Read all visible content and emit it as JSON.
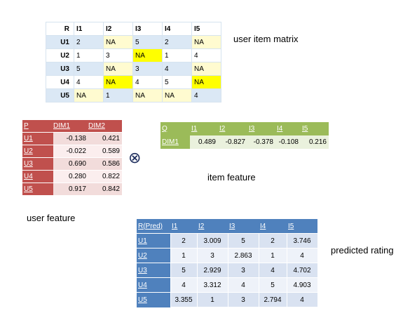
{
  "user_item_matrix": {
    "corner": "R",
    "columns": [
      "I1",
      "I2",
      "I3",
      "I4",
      "I5"
    ],
    "rows": [
      {
        "label": "U1",
        "values": [
          "2",
          "NA",
          "5",
          "2",
          "NA"
        ]
      },
      {
        "label": "U2",
        "values": [
          "1",
          "3",
          "NA",
          "1",
          "4"
        ]
      },
      {
        "label": "U3",
        "values": [
          "5",
          "NA",
          "3",
          "4",
          "NA"
        ]
      },
      {
        "label": "U4",
        "values": [
          "4",
          "NA",
          "4",
          "5",
          "NA"
        ]
      },
      {
        "label": "U5",
        "values": [
          "NA",
          "1",
          "NA",
          "NA",
          "4"
        ]
      }
    ],
    "caption": "user item matrix",
    "highlight_color": "#ffff00",
    "na_color": "#fffbd0"
  },
  "user_feature": {
    "corner": "P",
    "columns": [
      "DIM1",
      "DIM2"
    ],
    "rows": [
      {
        "label": "U1",
        "values": [
          "-0.138",
          "0.421"
        ]
      },
      {
        "label": "U2",
        "values": [
          "-0.022",
          "0.589"
        ]
      },
      {
        "label": "U3",
        "values": [
          "0.690",
          "0.586"
        ]
      },
      {
        "label": "U4",
        "values": [
          "0.280",
          "0.822"
        ]
      },
      {
        "label": "U5",
        "values": [
          "0.917",
          "0.842"
        ]
      }
    ],
    "caption": "user feature",
    "header_color": "#c0504d"
  },
  "operator_symbol": "⊗",
  "item_feature": {
    "corner": "Q",
    "columns": [
      "I1",
      "I2",
      "I3",
      "I4",
      "I5"
    ],
    "rows": [
      {
        "label": "DIM1",
        "values": [
          "0.489",
          "-0.827",
          "-0.378",
          "-0.108",
          "0.216"
        ]
      }
    ],
    "caption": "item feature",
    "header_color": "#9bbb59"
  },
  "predicted_rating": {
    "corner": "R(Pred)",
    "columns": [
      "I1",
      "I2",
      "I3",
      "I4",
      "I5"
    ],
    "rows": [
      {
        "label": "U1",
        "values": [
          "2",
          "3.009",
          "5",
          "2",
          "3.746"
        ]
      },
      {
        "label": "U2",
        "values": [
          "1",
          "3",
          "2.863",
          "1",
          "4"
        ]
      },
      {
        "label": "U3",
        "values": [
          "5",
          "2.929",
          "3",
          "4",
          "4.702"
        ]
      },
      {
        "label": "U4",
        "values": [
          "4",
          "3.312",
          "4",
          "5",
          "4.903"
        ]
      },
      {
        "label": "U5",
        "values": [
          "3.355",
          "1",
          "3",
          "2.794",
          "4"
        ]
      }
    ],
    "caption": "predicted rating",
    "header_color": "#4f81bd"
  }
}
